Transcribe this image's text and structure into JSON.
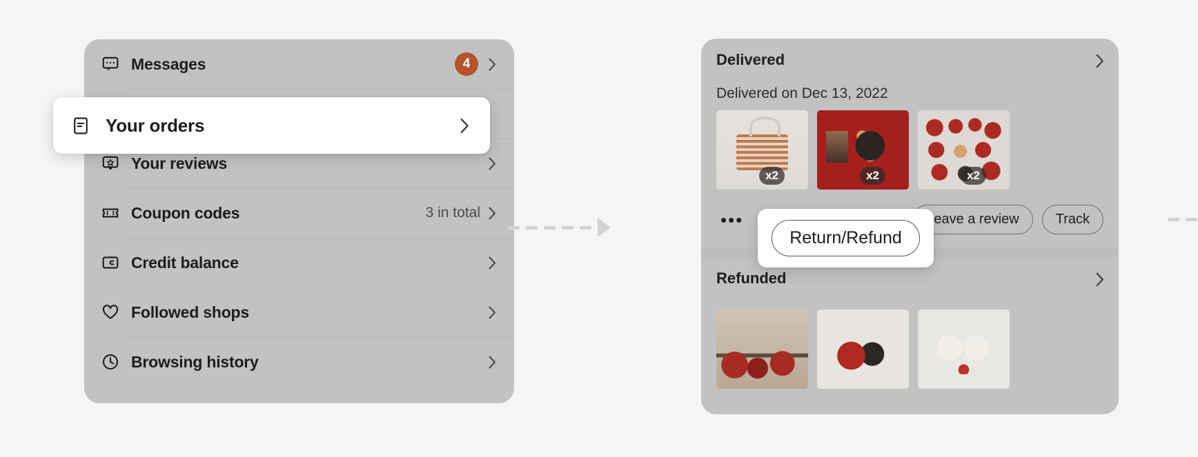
{
  "background_color": "#f5f5f5",
  "panel_color": "#c2c2c2",
  "accent_badge_color": "#b4532d",
  "account_menu": {
    "items": [
      {
        "label": "Messages",
        "icon": "chat-bubble-icon",
        "badge": "4",
        "meta": ""
      },
      {
        "label": "Your reviews",
        "icon": "review-star-icon",
        "badge": "",
        "meta": ""
      },
      {
        "label": "Coupon codes",
        "icon": "ticket-icon",
        "badge": "",
        "meta": "3 in total"
      },
      {
        "label": "Credit balance",
        "icon": "wallet-icon",
        "badge": "",
        "meta": ""
      },
      {
        "label": "Followed shops",
        "icon": "heart-icon",
        "badge": "",
        "meta": ""
      },
      {
        "label": "Browsing history",
        "icon": "clock-icon",
        "badge": "",
        "meta": ""
      }
    ]
  },
  "highlighted_menu_item": {
    "label": "Your orders",
    "icon": "document-list-icon",
    "chevron": "chevron-right-icon"
  },
  "orders_panel": {
    "groups": [
      {
        "title": "Delivered",
        "subtitle": "Delivered on Dec 13, 2022",
        "chevron": "chevron-right-icon",
        "thumbnails": [
          {
            "name": "cookie-jar-thumbnail",
            "qty": "x2"
          },
          {
            "name": "money-tree-thumbnail",
            "qty": "x2"
          },
          {
            "name": "new-year-charms-thumbnail",
            "qty": "x2"
          }
        ],
        "actions": {
          "more": "•••",
          "buttons": [
            "Return/Refund",
            "Leave a review",
            "Track"
          ]
        }
      },
      {
        "title": "Refunded",
        "subtitle": "",
        "chevron": "chevron-right-icon",
        "thumbnails": [
          {
            "name": "christmas-gnomes-thumbnail",
            "qty": ""
          },
          {
            "name": "santa-reindeer-thumbnail",
            "qty": ""
          },
          {
            "name": "white-deer-thumbnail",
            "qty": ""
          }
        ]
      }
    ]
  },
  "highlighted_action": {
    "label": "Return/Refund"
  },
  "connector": {
    "name": "dashed-arrow",
    "dash_count": 5
  }
}
